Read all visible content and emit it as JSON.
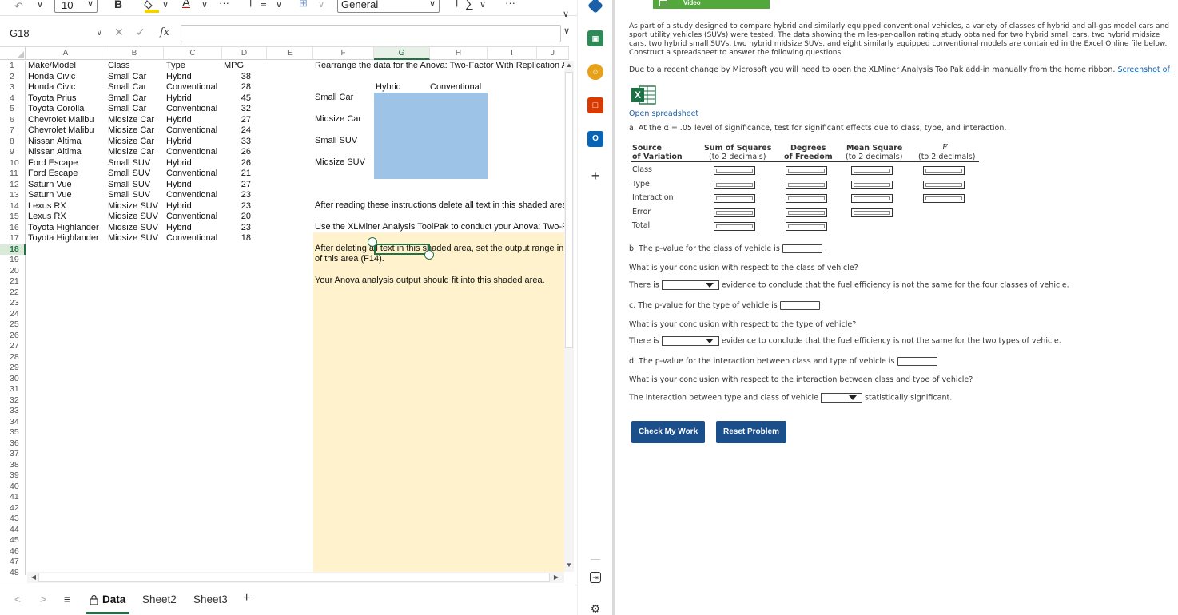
{
  "ribbon": {
    "font_size": "10",
    "bold": "B",
    "number_format": "General",
    "more": "···"
  },
  "formula_bar": {
    "name_box": "G18",
    "fx": "fx",
    "cancel": "✕",
    "confirm": "✓"
  },
  "columns": [
    "A",
    "B",
    "C",
    "D",
    "E",
    "F",
    "G",
    "H",
    "I",
    "J"
  ],
  "selected_column": "G",
  "rows": [
    "1",
    "2",
    "3",
    "4",
    "5",
    "6",
    "7",
    "8",
    "9",
    "10",
    "11",
    "12",
    "13",
    "14",
    "15",
    "16",
    "17",
    "18",
    "19",
    "20",
    "21",
    "22",
    "23",
    "24",
    "25",
    "26",
    "27",
    "28",
    "29",
    "30",
    "31",
    "32",
    "33",
    "34",
    "35",
    "36",
    "37",
    "38",
    "39",
    "40",
    "41",
    "42",
    "43",
    "44",
    "45",
    "46",
    "47",
    "48"
  ],
  "selected_row": "18",
  "table": {
    "headers": [
      "Make/Model",
      "Class",
      "Type",
      "MPG"
    ],
    "rows": [
      [
        "Honda Civic",
        "Small Car",
        "Hybrid",
        "38"
      ],
      [
        "Honda Civic",
        "Small Car",
        "Conventional",
        "28"
      ],
      [
        "Toyota Prius",
        "Small Car",
        "Hybrid",
        "45"
      ],
      [
        "Toyota Corolla",
        "Small Car",
        "Conventional",
        "32"
      ],
      [
        "Chevrolet Malibu",
        "Midsize Car",
        "Hybrid",
        "27"
      ],
      [
        "Chevrolet Malibu",
        "Midsize Car",
        "Conventional",
        "24"
      ],
      [
        "Nissan Altima",
        "Midsize Car",
        "Hybrid",
        "33"
      ],
      [
        "Nissan Altima",
        "Midsize Car",
        "Conventional",
        "26"
      ],
      [
        "Ford Escape",
        "Small SUV",
        "Hybrid",
        "26"
      ],
      [
        "Ford Escape",
        "Small SUV",
        "Conventional",
        "21"
      ],
      [
        "Saturn Vue",
        "Small SUV",
        "Hybrid",
        "27"
      ],
      [
        "Saturn Vue",
        "Small SUV",
        "Conventional",
        "23"
      ],
      [
        "Lexus RX",
        "Midsize SUV",
        "Hybrid",
        "23"
      ],
      [
        "Lexus RX",
        "Midsize SUV",
        "Conventional",
        "20"
      ],
      [
        "Toyota Highlander",
        "Midsize SUV",
        "Hybrid",
        "23"
      ],
      [
        "Toyota Highlander",
        "Midsize SUV",
        "Conventional",
        "18"
      ]
    ]
  },
  "rearrange": {
    "title": "Rearrange the data for the Anova: Two-Factor With Replication An",
    "col_hybrid": "Hybrid",
    "col_conventional": "Conventional",
    "row_labels": [
      "Small Car",
      "Midsize Car",
      "Small SUV",
      "Midsize SUV"
    ]
  },
  "instructions": {
    "line1": "After reading these instructions delete all text in this shaded area.",
    "line2": "Use the XLMiner Analysis ToolPak to conduct your Anova: Two-Fa",
    "line3a": "After deleting all text in this shaded area, set the output range in th",
    "line3b": "of this area (F14).",
    "line4": "Your Anova analysis output should fit into this shaded area."
  },
  "sheet_tabs": [
    "Data",
    "Sheet2",
    "Sheet3"
  ],
  "active_tab": "Data",
  "panel": {
    "video_label": "Video",
    "intro": "As part of a study designed to compare hybrid and similarly equipped conventional vehicles, a variety of classes of hybrid and all-gas model cars and sport utility vehicles (SUVs) were tested. The data showing the miles-per-gallon rating study obtained for two hybrid small cars, two hybrid midsize cars, two hybrid small SUVs, two hybrid midsize SUVs, and eight similarly equipped conventional models are contained in the Excel Online file below. Construct a spreadsheet to answer the following questions.",
    "notice": "Due to a recent change by Microsoft you will need to open the XLMiner Analysis ToolPak add-in manually from the home ribbon.",
    "notice_link": "Screenshot of ToolPak",
    "open_spreadsheet": "Open spreadsheet",
    "part_a": "a. At the α = .05 level of significance, test for significant effects due to class, type, and interaction.",
    "anova_headers": {
      "source": "Source",
      "source2": "of Variation",
      "ss": "Sum of Squares",
      "ss2": "(to 2 decimals)",
      "df": "Degrees",
      "df2": "of Freedom",
      "ms": "Mean Square",
      "ms2": "(to 2 decimals)",
      "f": "F",
      "f2": "(to 2 decimals)"
    },
    "anova_rows": [
      "Class",
      "Type",
      "Interaction",
      "Error",
      "Total"
    ],
    "part_b": "b. The p-value for the class of vehicle is",
    "q_b": "What is your conclusion with respect to the class of vehicle?",
    "there_is": "There is",
    "b_tail": "evidence to conclude that the fuel efficiency is not the same for the four classes of vehicle.",
    "part_c": "c. The p-value for the type of vehicle is",
    "q_c": "What is your conclusion with respect to the type of vehicle?",
    "c_tail": "evidence to conclude that the fuel efficiency is not the same for the two types of vehicle.",
    "part_d": "d. The p-value for the interaction between class and type of vehicle is",
    "q_d": "What is your conclusion with respect to the interaction between class and type of vehicle?",
    "d_head": "The interaction between type and class of vehicle",
    "d_tail": "statistically significant.",
    "check_button": "Check My Work",
    "reset_button": "Reset Problem"
  }
}
